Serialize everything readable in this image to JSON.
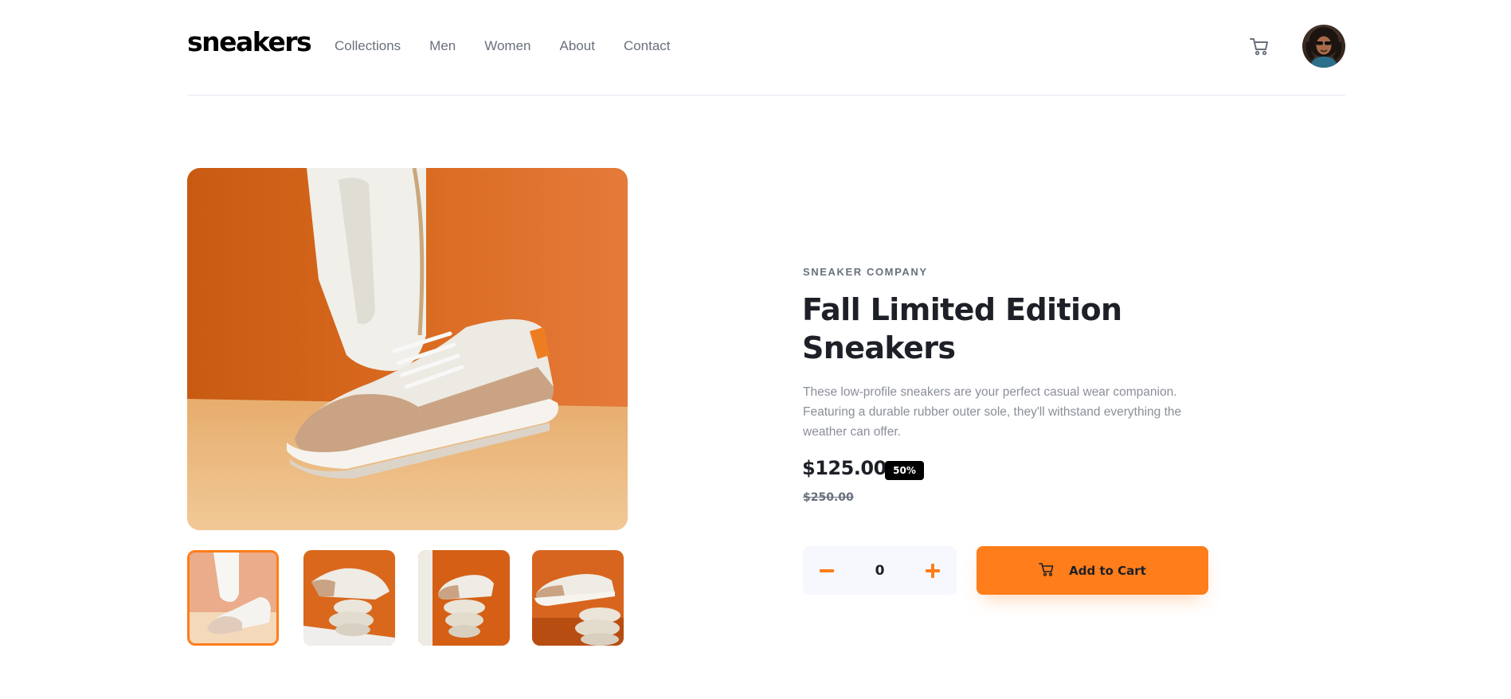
{
  "header": {
    "logo": "sneakers",
    "nav": [
      "Collections",
      "Men",
      "Women",
      "About",
      "Contact"
    ],
    "cart_icon": "cart-icon",
    "avatar_icon": "user-avatar"
  },
  "gallery": {
    "thumbnail_count": 4,
    "active_thumbnail": 1
  },
  "product": {
    "company": "SNEAKER COMPANY",
    "title": "Fall Limited Edition Sneakers",
    "description": "These low-profile sneakers are your perfect casual wear companion. Featuring a durable rubber outer sole, they'll withstand everything the weather can offer.",
    "price": "$125.00",
    "discount": "50%",
    "original_price": "$250.00"
  },
  "cart_controls": {
    "minus_icon": "minus-icon",
    "quantity": "0",
    "plus_icon": "plus-icon",
    "add_label": "Add to Cart"
  },
  "colors": {
    "accent": "#ff7d1a",
    "text_dark": "#1d2026",
    "text_muted": "#69707d",
    "qty_bg": "#f6f8fd"
  }
}
